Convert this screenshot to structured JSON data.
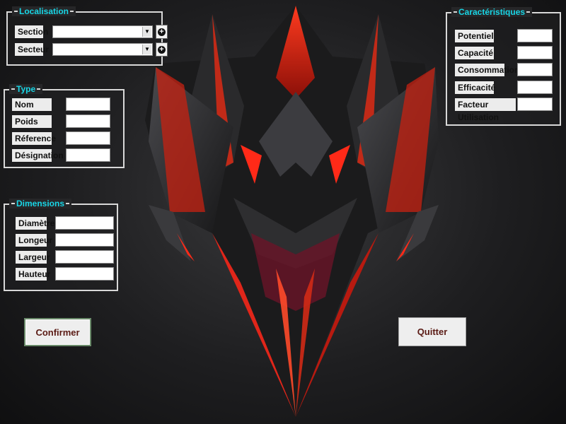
{
  "localisation": {
    "title": "Localisation",
    "section_label": "Section",
    "section_value": "",
    "secteur_label": "Secteur",
    "secteur_value": ""
  },
  "type": {
    "title": "Type",
    "fields": [
      {
        "label": "Nom",
        "value": ""
      },
      {
        "label": "Poids",
        "value": ""
      },
      {
        "label": "Réference",
        "value": ""
      },
      {
        "label": "Désignation",
        "value": ""
      }
    ]
  },
  "dimensions": {
    "title": "Dimensions",
    "fields": [
      {
        "label": "Diamètre",
        "value": ""
      },
      {
        "label": "Longeur",
        "value": ""
      },
      {
        "label": "Largeur",
        "value": ""
      },
      {
        "label": "Hauteur",
        "value": ""
      }
    ]
  },
  "caracteristiques": {
    "title": "Caractéristiques",
    "fields": [
      {
        "label": "Potentiel",
        "value": ""
      },
      {
        "label": "Capacité",
        "value": ""
      },
      {
        "label": "Consommation",
        "value": ""
      },
      {
        "label": "Efficacité",
        "value": ""
      },
      {
        "label": "Facteur Utilisation",
        "value": ""
      }
    ]
  },
  "buttons": {
    "confirm_label": "Confirmer",
    "quit_label": "Quitter"
  },
  "colors": {
    "group_title": "#18d6e6",
    "accent_red": "#e0261a",
    "button_text": "#5a1a14"
  },
  "icons": {
    "add": "plus-circle-icon",
    "dropdown": "chevron-down-icon"
  }
}
